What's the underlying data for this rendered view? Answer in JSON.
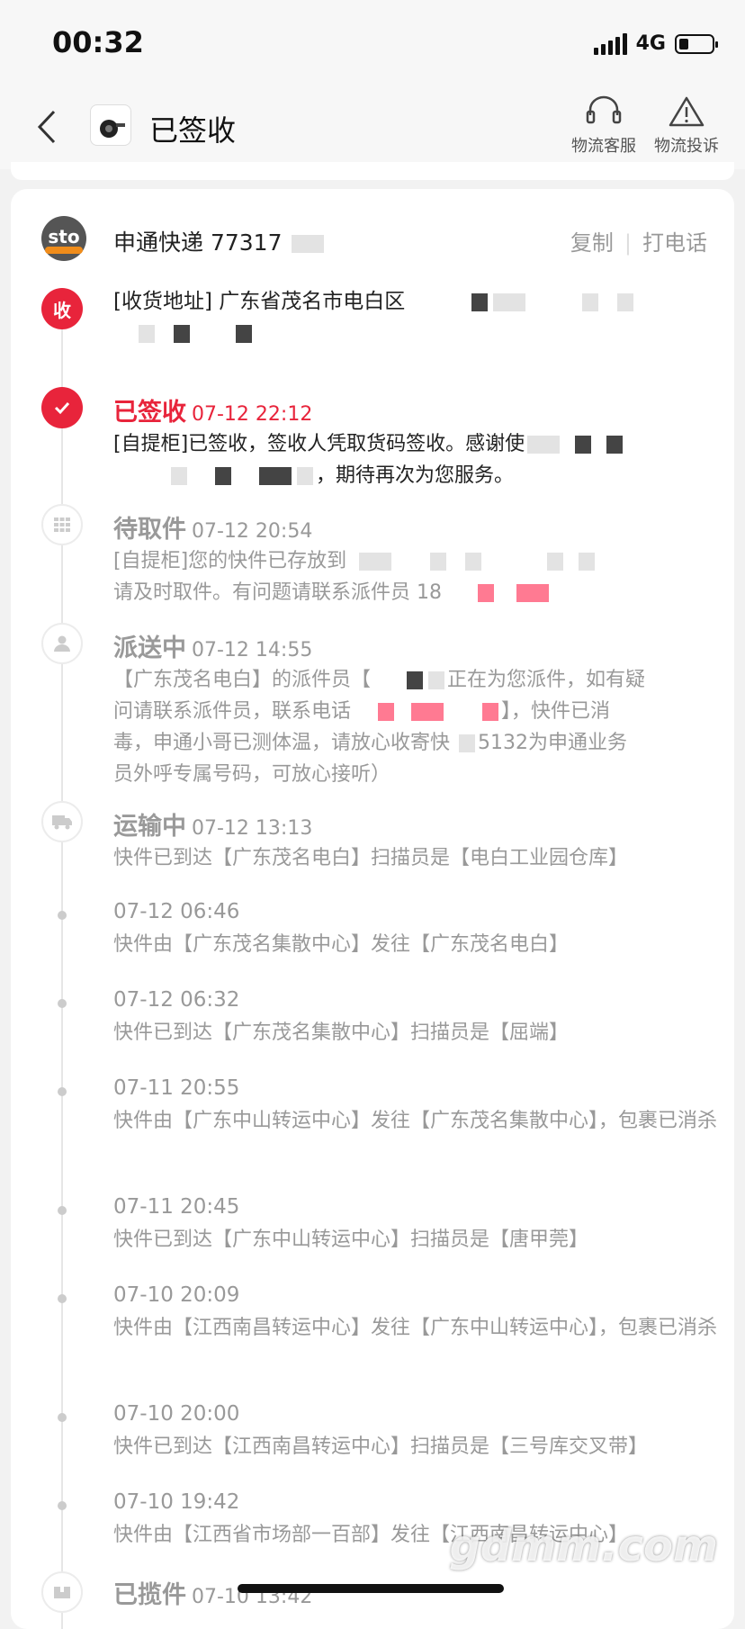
{
  "status_bar": {
    "time": "00:32",
    "network": "4G"
  },
  "header": {
    "title": "已签收",
    "actions": [
      {
        "label": "物流客服",
        "icon": "headset-icon"
      },
      {
        "label": "物流投诉",
        "icon": "warning-icon"
      }
    ]
  },
  "carrier": {
    "logo_text": "sto",
    "name": "申通快递 77317",
    "copy_label": "复制",
    "call_label": "打电话"
  },
  "address": {
    "node_label": "收",
    "text": "[收货地址] 广东省茂名市电白区"
  },
  "events": [
    {
      "status": "已签收",
      "time": "07-12 22:12",
      "text_a": "[自提柜]已签收，签收人凭取货码签收。感谢使",
      "text_b": "，期待再次为您服务。"
    },
    {
      "status": "待取件",
      "time": "07-12 20:54",
      "text_a": "[自提柜]您的快件已存放到",
      "text_b": "请及时取件。有问题请联系派件员 18"
    },
    {
      "status": "派送中",
      "time": "07-12 14:55",
      "text_a": "【广东茂名电白】的派件员【",
      "text_b": "正在为您派件，如有疑",
      "text_c": "问请联系派件员，联系电话",
      "text_d": "】，快件已消",
      "text_e": "毒，申通小哥已测体温，请放心收寄快",
      "text_f": "5132为申通业务",
      "text_g": "员外呼专属号码，可放心接听）"
    },
    {
      "status": "运输中",
      "time": "07-12 13:13",
      "text_a": "快件已到达【广东茂名电白】扫描员是【电白工业园仓库】"
    }
  ],
  "minor_events": [
    {
      "time": "07-12 06:46",
      "text": "快件由【广东茂名集散中心】发往【广东茂名电白】"
    },
    {
      "time": "07-12 06:32",
      "text": "快件已到达【广东茂名集散中心】扫描员是【屈端】"
    },
    {
      "time": "07-11 20:55",
      "text": "快件由【广东中山转运中心】发往【广东茂名集散中心】，包裹已消杀"
    },
    {
      "time": "07-11 20:45",
      "text": "快件已到达【广东中山转运中心】扫描员是【唐甲莞】"
    },
    {
      "time": "07-10 20:09",
      "text": "快件由【江西南昌转运中心】发往【广东中山转运中心】，包裹已消杀"
    },
    {
      "time": "07-10 20:00",
      "text": "快件已到达【江西南昌转运中心】扫描员是【三号库交叉带】"
    },
    {
      "time": "07-10 19:42",
      "text": "快件由【江西省市场部一百部】发往【江西南昌转运中心】"
    }
  ],
  "last_event": {
    "status": "已揽件",
    "time": "07-10 13:42"
  },
  "watermark": "gdmm.com",
  "colors": {
    "accent": "#e8243b",
    "muted": "#999999",
    "background": "#f2f2f2"
  }
}
